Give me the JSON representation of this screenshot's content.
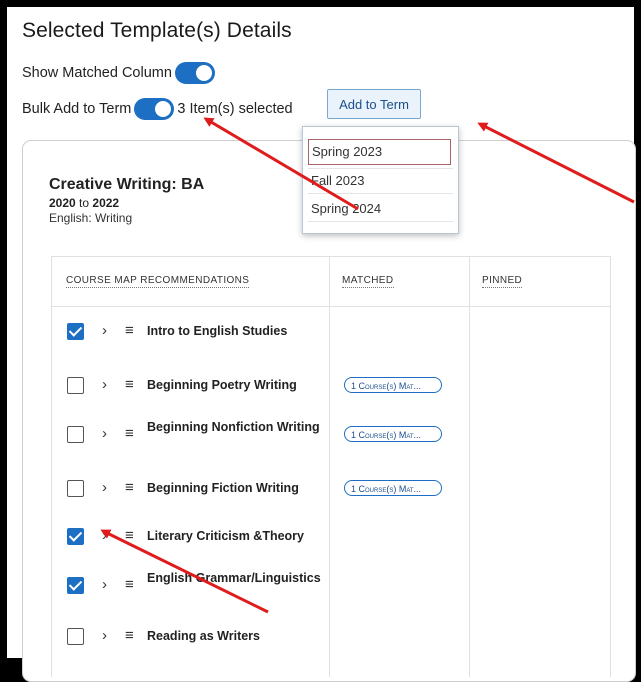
{
  "header": {
    "title": "Selected Template(s) Details"
  },
  "controls": {
    "show_matched_label": "Show Matched Column",
    "bulk_add_label": "Bulk Add to Term",
    "selected_count": "3 Item(s) selected",
    "add_to_term_label": "Add to Term"
  },
  "dropdown": {
    "options": [
      "Spring 2023",
      "Fall 2023",
      "Spring 2024"
    ],
    "selected": "Spring 2023"
  },
  "program": {
    "title": "Creative Writing: BA",
    "year_start": "2020",
    "year_to": "to",
    "year_end": "2022",
    "area": "English: Writing"
  },
  "table": {
    "headers": [
      "Course Map Recommendations",
      "Matched",
      "Pinned"
    ],
    "rows": [
      {
        "name": "Intro to English Studies",
        "checked": true,
        "matched": ""
      },
      {
        "name": "Beginning Poetry Writing",
        "checked": false,
        "matched": "1 Course(s) Mat..."
      },
      {
        "name": "Beginning Nonfiction Writing",
        "checked": false,
        "matched": "1 Course(s) Mat..."
      },
      {
        "name": "Beginning Fiction Writing",
        "checked": false,
        "matched": "1 Course(s) Mat..."
      },
      {
        "name": "Literary Criticism &Theory",
        "checked": true,
        "matched": ""
      },
      {
        "name": "English Grammar/Linguistics",
        "checked": true,
        "matched": ""
      },
      {
        "name": "Reading as Writers",
        "checked": false,
        "matched": ""
      }
    ]
  },
  "icons": {
    "expand": "chevron-right-icon",
    "drag": "menu-lines-icon"
  },
  "colors": {
    "accent": "#1c6fc2",
    "annotation_arrow": "#e01b1b"
  }
}
